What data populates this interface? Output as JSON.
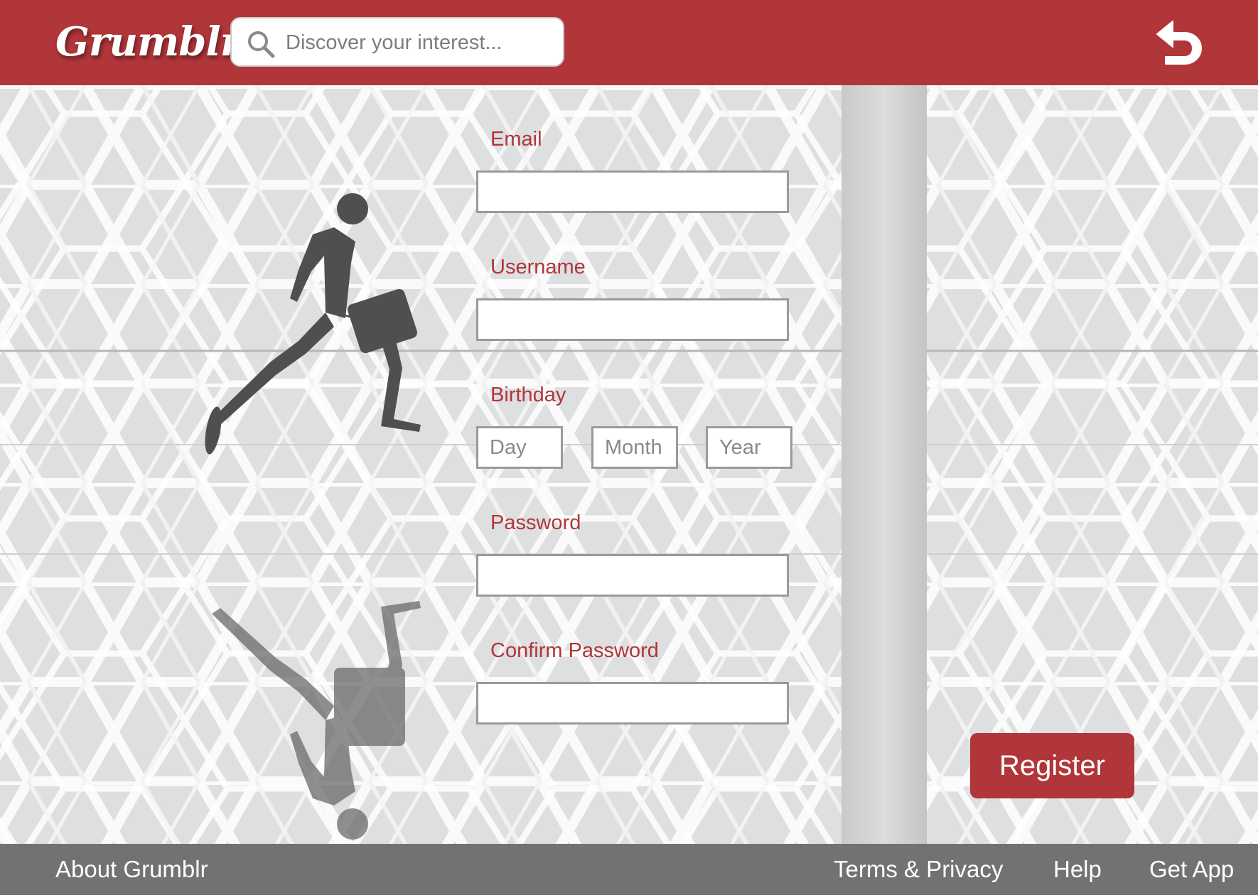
{
  "header": {
    "logo_text": "Grumblr",
    "search_placeholder": "Discover your interest...",
    "back_icon": "back-arrow-icon"
  },
  "form": {
    "email_label": "Email",
    "username_label": "Username",
    "birthday_label": "Birthday",
    "day_placeholder": "Day",
    "month_placeholder": "Month",
    "year_placeholder": "Year",
    "password_label": "Password",
    "confirm_password_label": "Confirm Password",
    "register_label": "Register"
  },
  "footer": {
    "about": "About Grumblr",
    "terms": "Terms & Privacy",
    "help": "Help",
    "get_app": "Get App"
  },
  "colors": {
    "brand_red": "#b0363a",
    "footer_gray": "#727272"
  }
}
